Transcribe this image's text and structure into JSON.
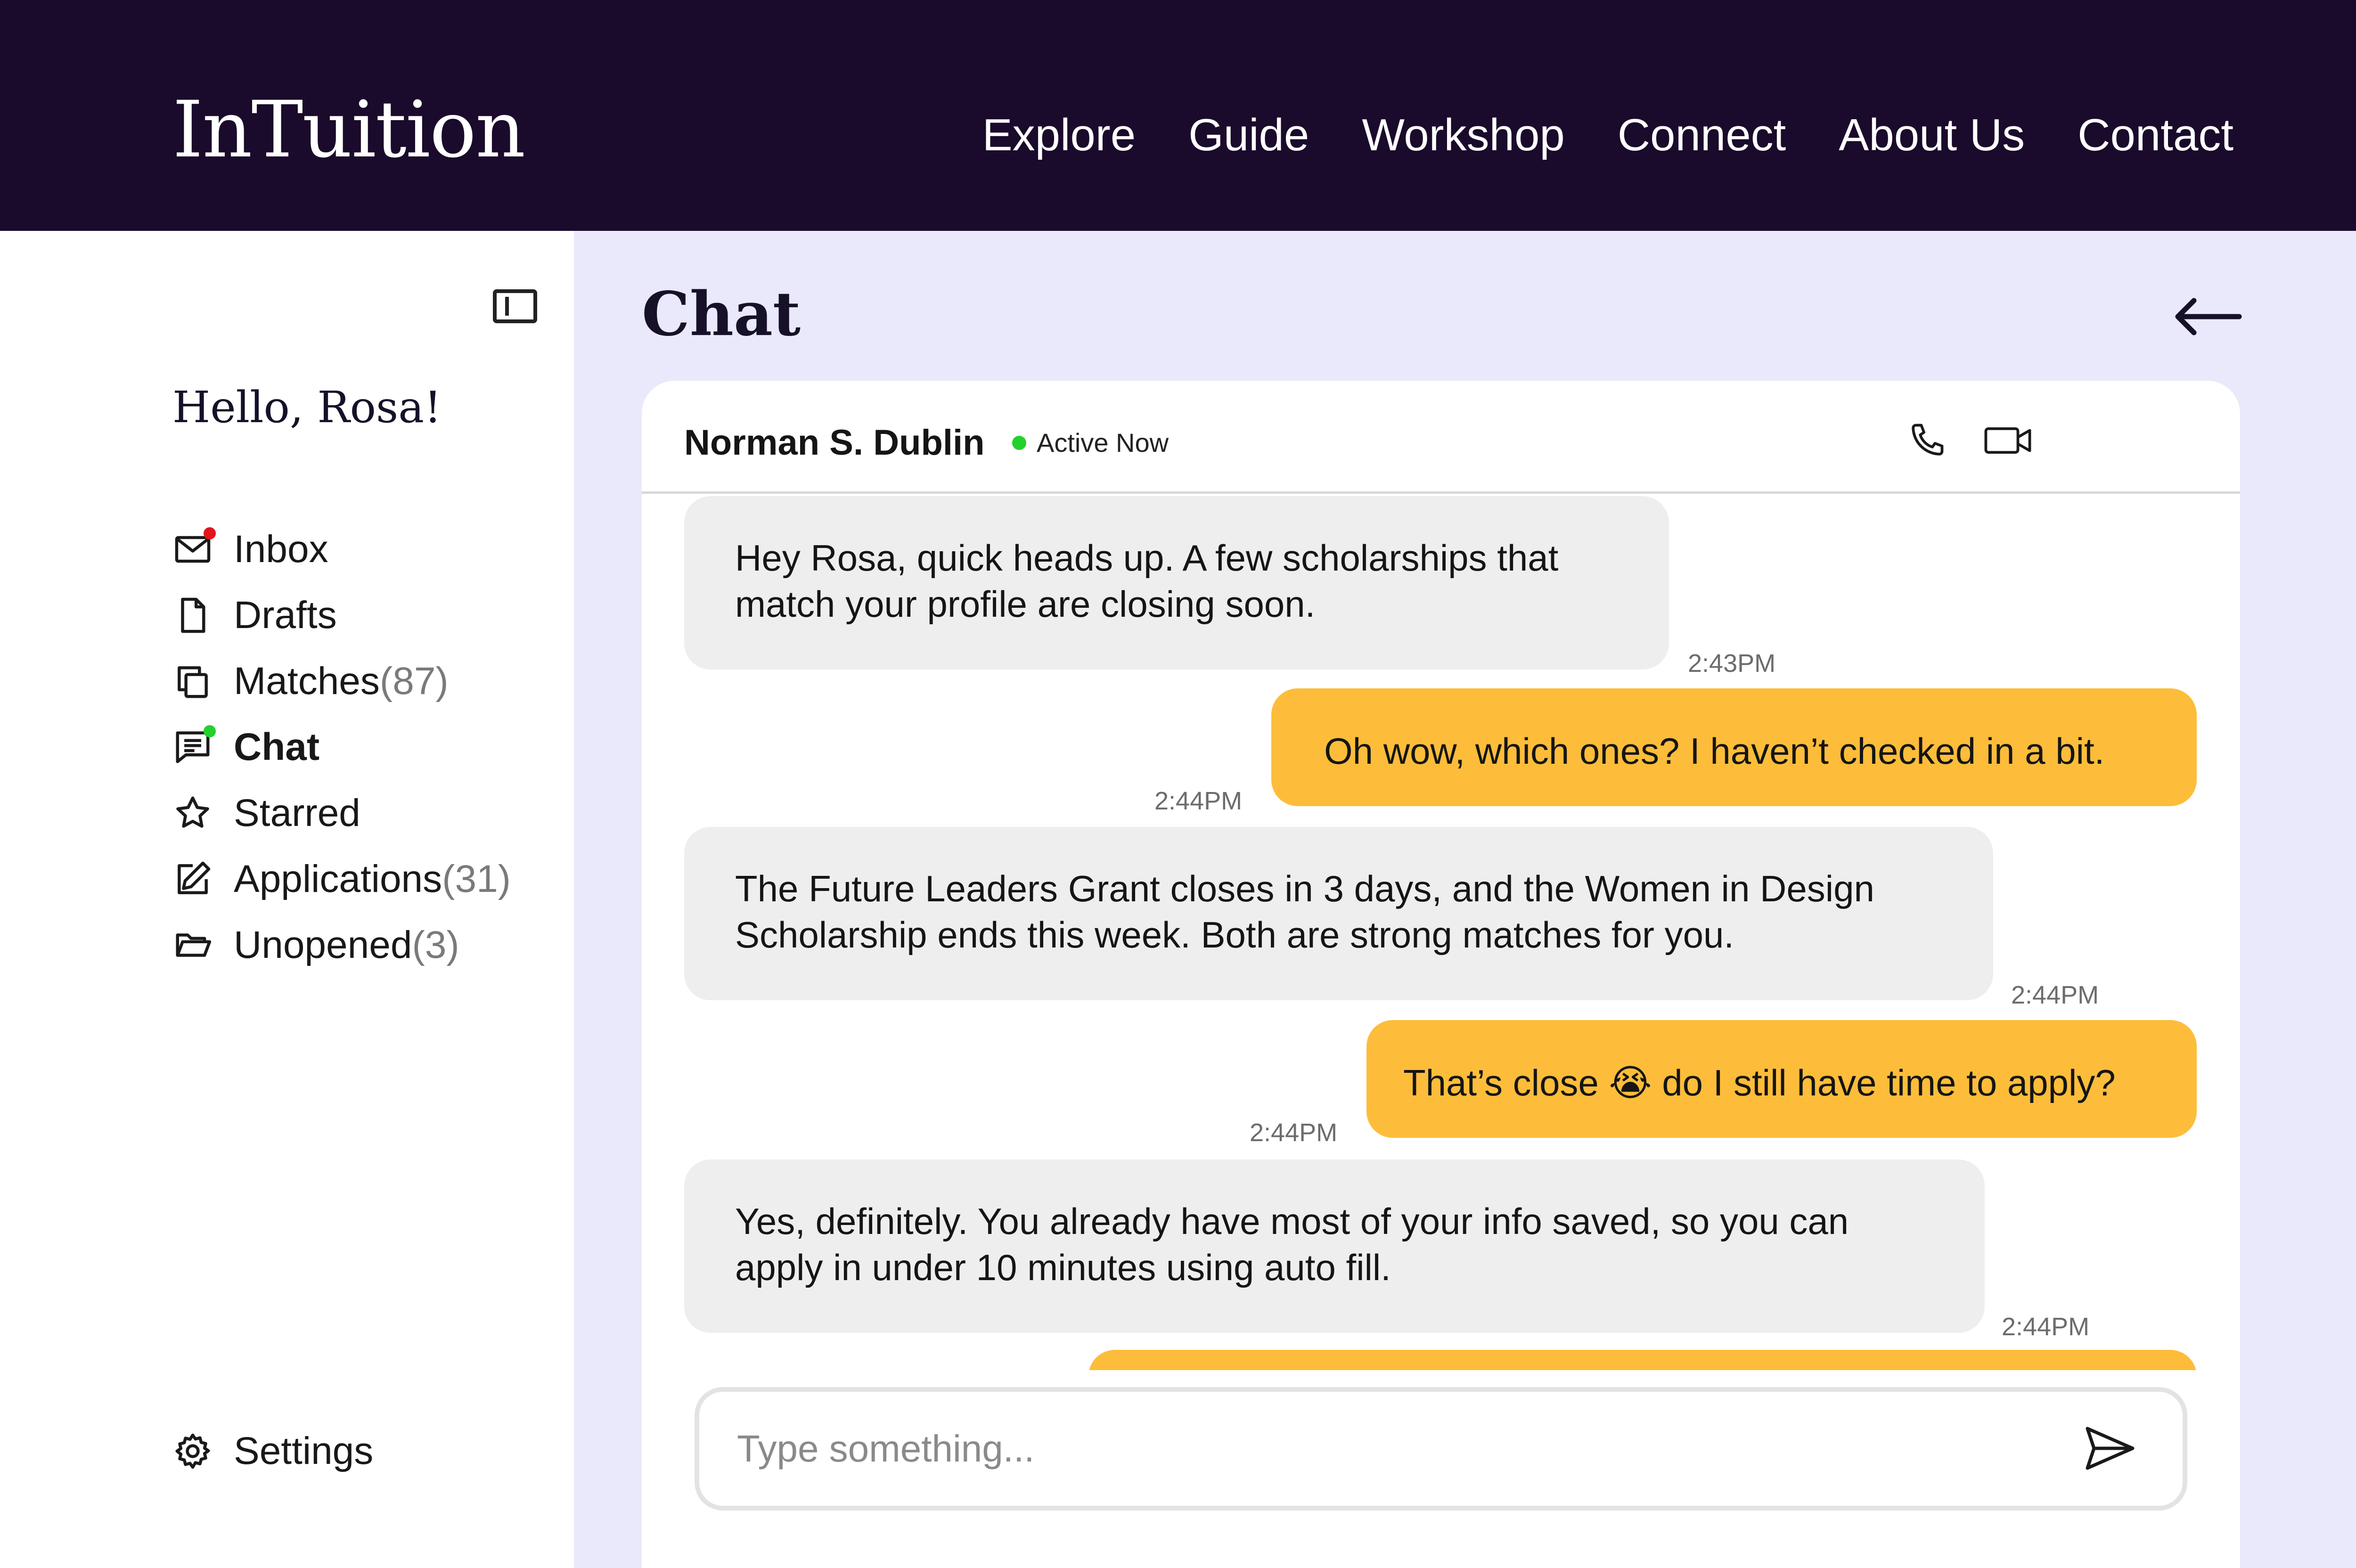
{
  "header": {
    "brand": "InTuition",
    "nav": [
      "Explore",
      "Guide",
      "Workshop",
      "Connect",
      "About Us",
      "Contact"
    ]
  },
  "sidebar": {
    "greeting": "Hello, Rosa!",
    "items": [
      {
        "label": "Inbox",
        "count": "",
        "icon": "mail-icon",
        "badge": "red"
      },
      {
        "label": "Drafts",
        "count": "",
        "icon": "document-icon",
        "badge": ""
      },
      {
        "label": "Matches",
        "count": "(87)",
        "icon": "copy-icon",
        "badge": ""
      },
      {
        "label": "Chat",
        "count": "",
        "icon": "chat-icon",
        "badge": "green",
        "active": true
      },
      {
        "label": "Starred",
        "count": "",
        "icon": "star-icon",
        "badge": ""
      },
      {
        "label": "Applications",
        "count": "(31)",
        "icon": "edit-icon",
        "badge": ""
      },
      {
        "label": "Unopened",
        "count": "(3)",
        "icon": "folder-open-icon",
        "badge": ""
      }
    ],
    "settings_label": "Settings"
  },
  "main": {
    "title": "Chat"
  },
  "chat": {
    "contact_name": "Norman S. Dublin",
    "status": "Active Now",
    "messages": [
      {
        "from": "in",
        "text": "Hey Rosa, quick heads up. A few scholarships that match your profile are closing soon.",
        "time": "2:43PM"
      },
      {
        "from": "out",
        "text": "Oh wow, which ones? I haven’t checked in a bit.",
        "time": "2:44PM"
      },
      {
        "from": "in",
        "text": "The Future Leaders Grant closes in 3 days, and the Women in Design Scholarship ends this week. Both are strong matches for you.",
        "time": "2:44PM"
      },
      {
        "from": "out",
        "text": "That’s close 😭 do I still have time to apply?",
        "time": "2:44PM"
      },
      {
        "from": "in",
        "text": "Yes, definitely. You already have most of your info saved, so you can apply in under 10 minutes using auto fill.",
        "time": "2:44PM"
      },
      {
        "from": "out",
        "text": "",
        "time": ""
      }
    ],
    "composer_placeholder": "Type something..."
  },
  "colors": {
    "header_bg": "#1a0a2b",
    "page_bg": "#e9e9fb",
    "incoming_bubble": "#eeeeee",
    "outgoing_bubble": "#fdbd3a",
    "inbox_badge": "#e3141b",
    "active_dot": "#22d12b"
  }
}
